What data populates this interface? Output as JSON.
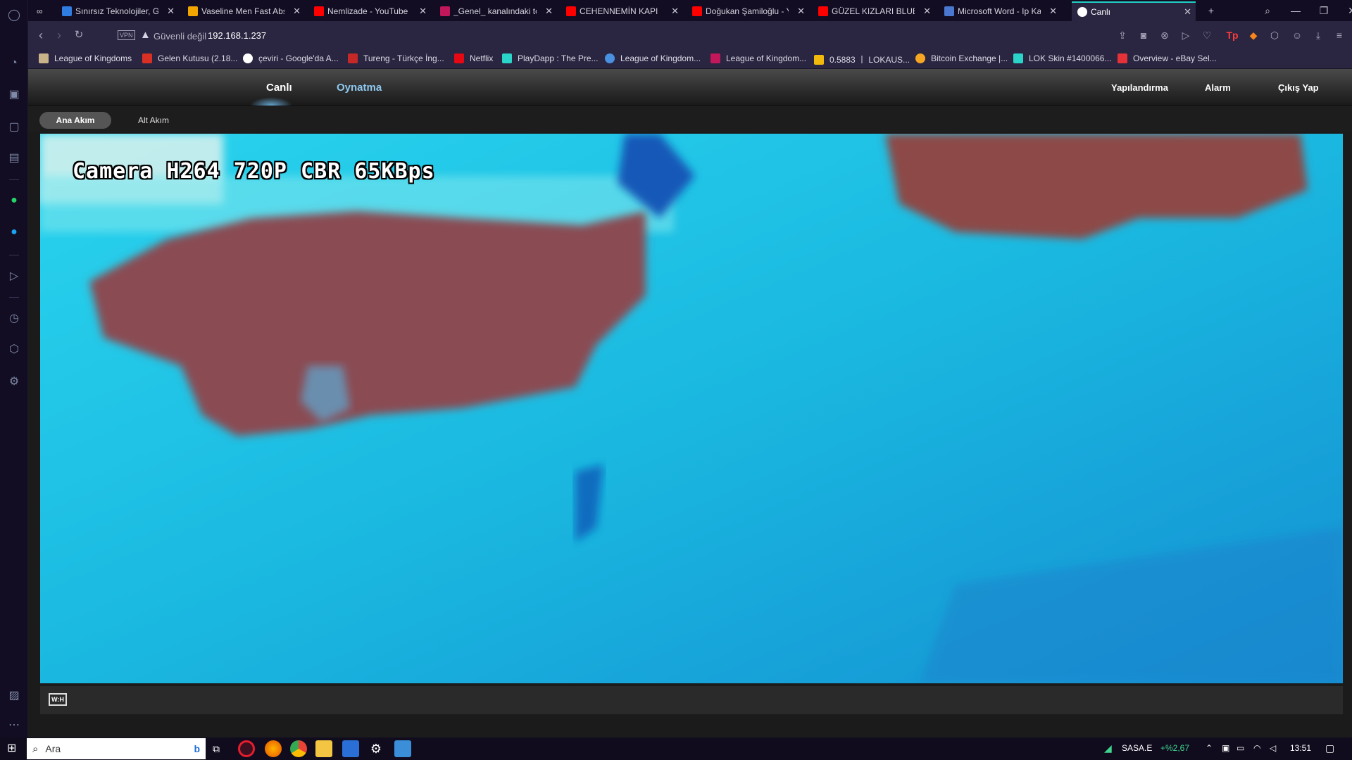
{
  "browser": {
    "tabs": [
      {
        "title": "Sınırsız Teknolojiler, Gü",
        "fav": "#2f7de0"
      },
      {
        "title": "Vaseline Men Fast Abso",
        "fav": "#f2a400"
      },
      {
        "title": "Nemlizade - YouTube",
        "fav": "#ff0000"
      },
      {
        "title": "_Genel_ kanalındaki top",
        "fav": "#c2185b"
      },
      {
        "title": "CEHENNEMİN KAPI",
        "fav": "#ff0000"
      },
      {
        "title": "Doğukan Şamiloğlu - Yo",
        "fav": "#ff0000"
      },
      {
        "title": "GÜZEL KIZLARI BLUETO",
        "fav": "#ff0000"
      },
      {
        "title": "Microsoft Word - Ip Kar",
        "fav": "#4a78d0"
      },
      {
        "title": "Canlı",
        "fav": "#ffffff"
      }
    ],
    "address": {
      "vpn": "VPN",
      "security": "Güvenli değil",
      "url": "192.168.1.237"
    },
    "bookmarks": [
      {
        "label": "League of Kingdoms",
        "fav": "#c9b48a"
      },
      {
        "label": "Gelen Kutusu (2.18...",
        "fav": "#d93025"
      },
      {
        "label": "çeviri - Google'da A...",
        "fav": "#ffffff"
      },
      {
        "label": "Tureng - Türkçe İng...",
        "fav": "#c62828"
      },
      {
        "label": "Netflix",
        "fav": "#e50914"
      },
      {
        "label": "PlayDapp : The Pre...",
        "fav": "#2bd4c8"
      },
      {
        "label": "League of Kingdom...",
        "fav": "#4a90e2"
      },
      {
        "label": "League of Kingdom...",
        "fav": "#c2185b"
      },
      {
        "label": "0.5883 丨 LOKAUS...",
        "fav": "#f0b90b"
      },
      {
        "label": "Bitcoin Exchange |...",
        "fav": "#f5a623"
      },
      {
        "label": "LOK Skin #1400066...",
        "fav": "#2bd4c8"
      },
      {
        "label": "Overview - eBay Sel...",
        "fav": "#e53238"
      }
    ]
  },
  "camera_app": {
    "nav": {
      "live": "Canlı",
      "playback": "Oynatma",
      "config": "Yapılandırma",
      "alarm": "Alarm",
      "logout": "Çıkış Yap"
    },
    "streams": {
      "main": "Ana Akım",
      "sub": "Alt Akım"
    },
    "osd": "Camera H264 720P CBR 65KBps",
    "ratio_button": "W:H"
  },
  "taskbar": {
    "search_placeholder": "Ara",
    "stock_symbol": "SASA.E",
    "stock_change": "+%2,67",
    "clock": "13:51"
  },
  "colors": {
    "accent": "#21d0c5",
    "nav_link": "#8ec8ee",
    "stock_up": "#3dd68c"
  }
}
